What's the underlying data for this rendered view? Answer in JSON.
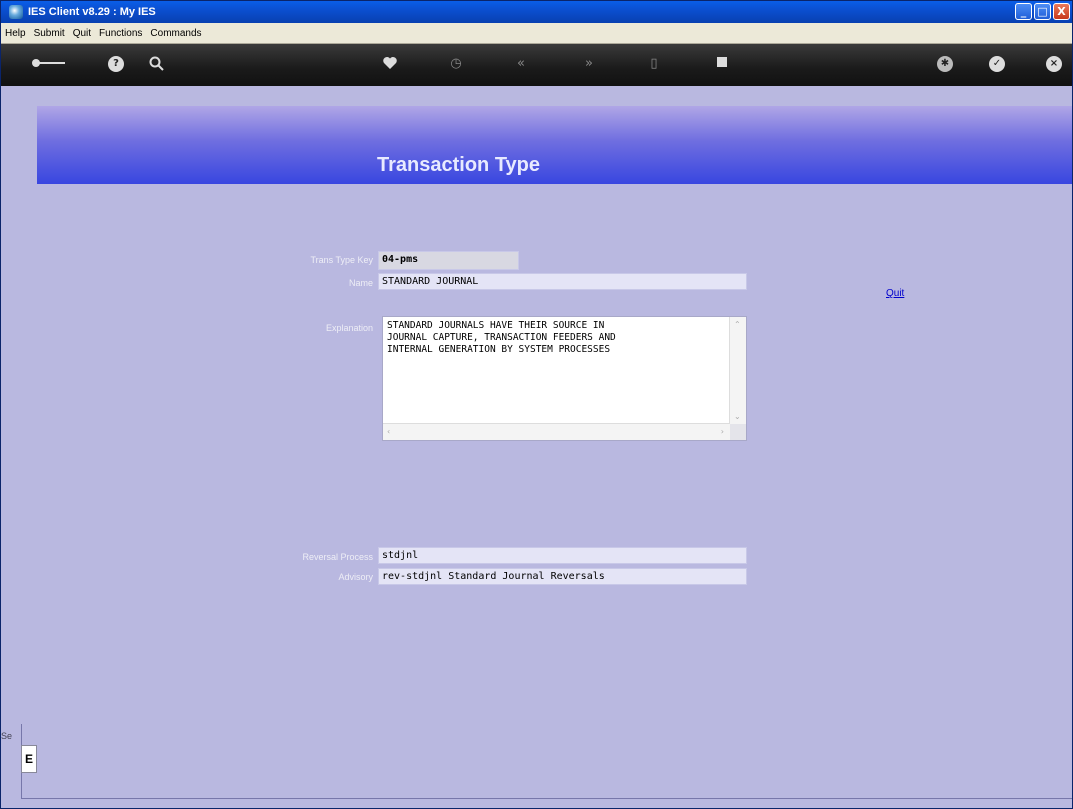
{
  "window": {
    "title": "IES Client v8.29 : My IES",
    "controls": [
      "_",
      "□",
      "X"
    ]
  },
  "menu": [
    "Help",
    "Submit",
    "Quit",
    "Functions",
    "Commands"
  ],
  "toolbar": {
    "icons": [
      "key-icon",
      "help-icon",
      "search-icon",
      "heart-icon",
      "clock-icon",
      "back-icon",
      "forward-icon",
      "document-icon",
      "stop-icon",
      "options-icon",
      "ok-icon",
      "close-icon"
    ]
  },
  "page": {
    "title": "Transaction Type",
    "quit_link": "Quit"
  },
  "form": {
    "trans_type_key": {
      "label": "Trans Type Key",
      "value": "04-pms"
    },
    "name": {
      "label": "Name",
      "value": "STANDARD JOURNAL"
    },
    "explanation": {
      "label": "Explanation",
      "value": "STANDARD JOURNALS HAVE THEIR SOURCE IN\nJOURNAL CAPTURE, TRANSACTION FEEDERS AND\nINTERNAL GENERATION BY SYSTEM PROCESSES"
    },
    "reversal_process": {
      "label": "Reversal Process",
      "value": "stdjnl"
    },
    "advisory": {
      "label": "Advisory",
      "value": "rev-stdjnl Standard Journal Reversals"
    }
  },
  "side": {
    "label": "Se",
    "box": "E"
  }
}
